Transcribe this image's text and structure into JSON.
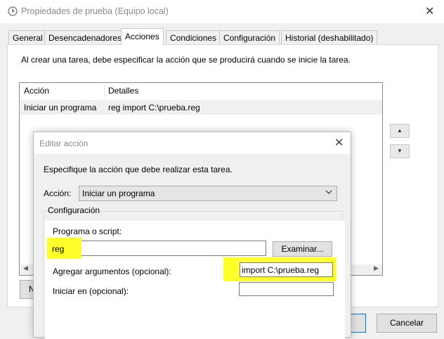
{
  "window": {
    "title": "Propiedades de prueba (Equipo local)",
    "close": "✕"
  },
  "tabs": [
    {
      "label": "General"
    },
    {
      "label": "Desencadenadores"
    },
    {
      "label": "Acciones"
    },
    {
      "label": "Condiciones"
    },
    {
      "label": "Configuración"
    },
    {
      "label": "Historial (deshabilitado)"
    }
  ],
  "active_tab": "Acciones",
  "actions_tab": {
    "intro": "Al crear una tarea, debe especificar la acción que se producirá cuando se inicie la tarea.",
    "columns": [
      "Acción",
      "Detalles"
    ],
    "rows": [
      {
        "action": "Iniciar un programa",
        "details": "reg import C:\\prueba.reg"
      }
    ],
    "move_up_icon": "triangle-up",
    "move_down_icon": "triangle-down",
    "new_button_partial": "N"
  },
  "footer": {
    "cancel_label": "Cancelar"
  },
  "dialog": {
    "title": "Editar acción",
    "close": "✕",
    "instructions": "Especifique la acción que debe realizar esta tarea.",
    "action_label": "Acción:",
    "action_value": "Iniciar un programa",
    "config_legend": "Configuración",
    "program_label": "Programa o script:",
    "program_value": "reg",
    "browse_label": "Examinar...",
    "args_label": "Agregar argumentos (opcional):",
    "args_value": "import C:\\prueba.reg",
    "start_label": "Iniciar en (opcional):",
    "start_value": ""
  },
  "colors": {
    "highlight": "#ffff2a",
    "focus_border": "#0078d7"
  }
}
